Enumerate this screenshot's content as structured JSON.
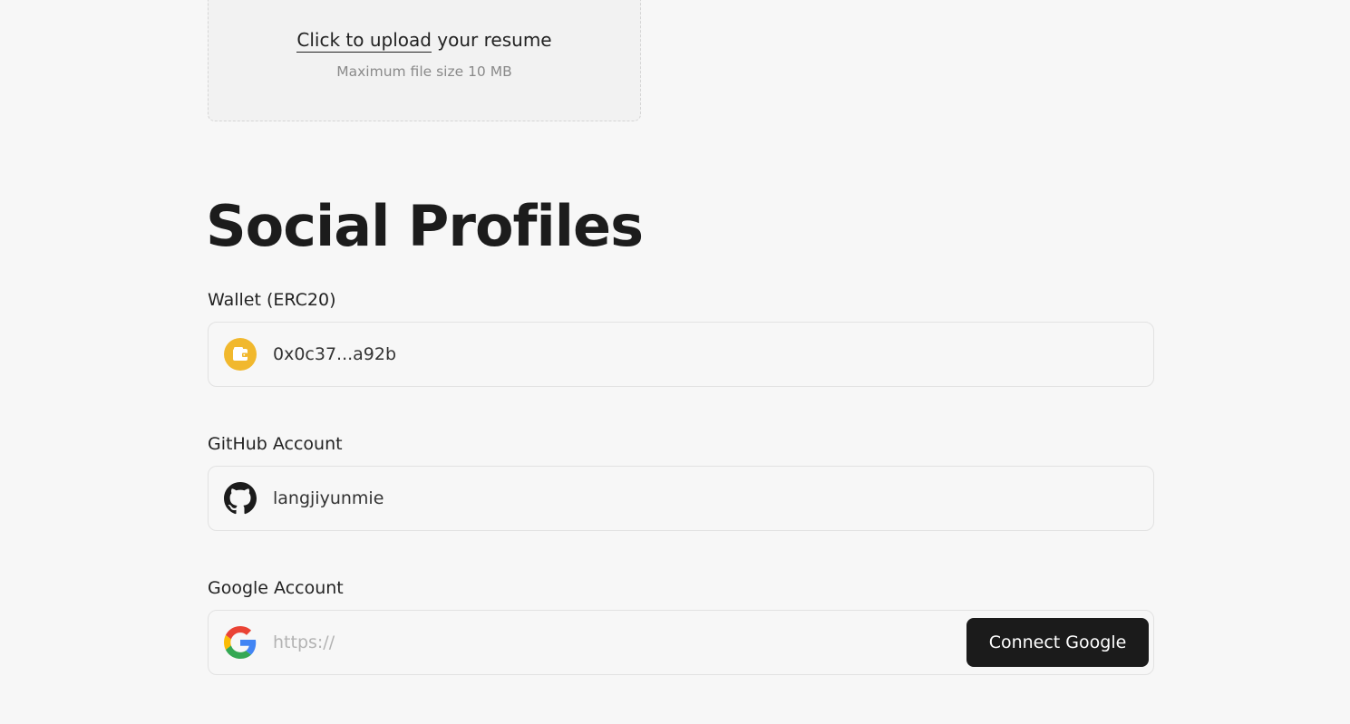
{
  "upload": {
    "link_text": "Click to upload",
    "suffix_text": " your resume",
    "hint": "Maximum file size 10 MB"
  },
  "social": {
    "title": "Social Profiles",
    "wallet": {
      "label": "Wallet (ERC20)",
      "value": "0x0c37...a92b",
      "icon": "wallet-icon",
      "icon_color": "#f1b82d"
    },
    "github": {
      "label": "GitHub Account",
      "value": "langjiyunmie",
      "icon": "github-icon"
    },
    "google": {
      "label": "Google Account",
      "placeholder": "https://",
      "icon": "google-icon",
      "button_label": "Connect Google"
    }
  },
  "colors": {
    "background": "#f7f7f7",
    "button": "#1b1b1b",
    "wallet_accent": "#f1b82d"
  }
}
